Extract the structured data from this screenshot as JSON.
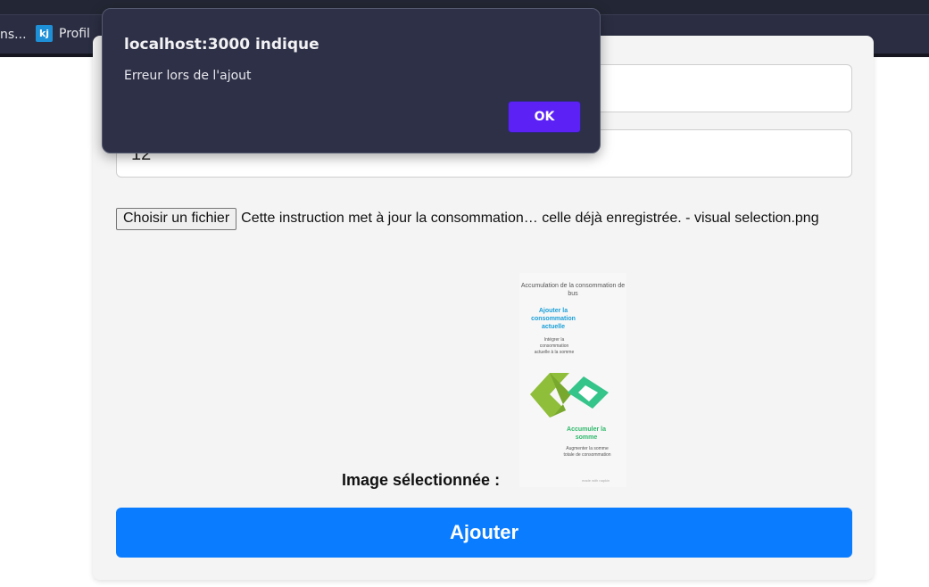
{
  "browser": {
    "bookmarks": [
      {
        "label": "ns..."
      },
      {
        "label": "Profil",
        "icon": "kj"
      }
    ]
  },
  "form": {
    "field1_value": "",
    "field2_value": "12",
    "file_button_label": "Choisir un fichier",
    "file_name": "Cette instruction met à jour la consommation… celle déjà enregistrée. - visual selection.png",
    "image_label": "Image sélectionnée :",
    "submit_label": "Ajouter",
    "submit_color": "#0a7cff"
  },
  "preview": {
    "title": "Accumulation de la consommation de bus",
    "step1_title": "Ajouter la consommation actuelle",
    "step1_desc": "Intégrer la consommation actuelle à la somme",
    "step2_title": "Accumuler la somme",
    "step2_desc": "Augmenter la somme totale de consommation",
    "credit": "made with napkin",
    "colors": {
      "step1": "#1a9fd8",
      "step2": "#2db86a",
      "shape_left": "#8fbe3a",
      "shape_right": "#35c48a"
    }
  },
  "dialog": {
    "title": "localhost:3000 indique",
    "message": "Erreur lors de l'ajout",
    "ok_label": "OK",
    "ok_color": "#5b21f5"
  }
}
